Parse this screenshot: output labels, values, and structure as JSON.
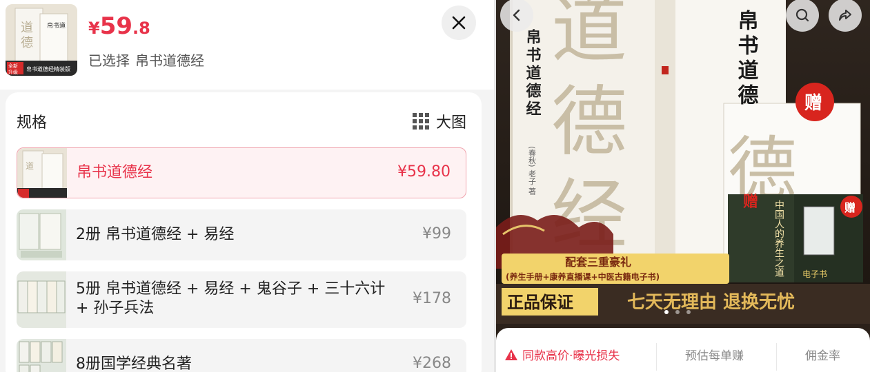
{
  "header": {
    "price_currency": "¥",
    "price_int": "59",
    "price_dec": ".8",
    "selected_label": "已选择",
    "selected_value": "帛书道德经"
  },
  "spec": {
    "title": "规格",
    "big_image_label": "大图",
    "options": [
      {
        "name": "帛书道德经",
        "price": "¥59.80",
        "selected": true
      },
      {
        "name": "2册 帛书道德经 + 易经",
        "price": "¥99",
        "selected": false
      },
      {
        "name": "5册 帛书道德经 + 易经 + 鬼谷子 + 三十六计",
        "name2": "+ 孙子兵法",
        "price": "¥178",
        "selected": false
      },
      {
        "name": "8册国学经典名著",
        "price": "¥268",
        "selected": false
      }
    ]
  },
  "thumb": {
    "badge_line1": "全新",
    "badge_line2": "升级",
    "caption": "帛书道德经精装版"
  },
  "banner": {
    "title_vertical": "帛书道德经",
    "title_right": "帛书道德",
    "big_char_1": "道",
    "big_char_2": "德",
    "big_char_3": "经",
    "author": "(春秋) 老子 著",
    "gift_badge": "赠",
    "gift_book_title": "中国人的养生之道",
    "gift_ebook_label": "电子书",
    "promo_line1": "配套三重豪礼",
    "promo_line2": "(养生手册+康养直播课+中医古籍电子书)",
    "genuine": "正品保证",
    "refund": "七天无理由 退换无忧"
  },
  "info": {
    "warning": "同款高价·曝光损失",
    "earn_label": "预估每单赚",
    "commission_label": "佣金率"
  },
  "colors": {
    "accent": "#e8334a",
    "banner_bg": "#2b211a",
    "gold": "#f2d36b"
  },
  "icons": [
    "close-icon",
    "grid-icon",
    "back-icon",
    "search-icon",
    "share-icon",
    "warning-icon"
  ]
}
